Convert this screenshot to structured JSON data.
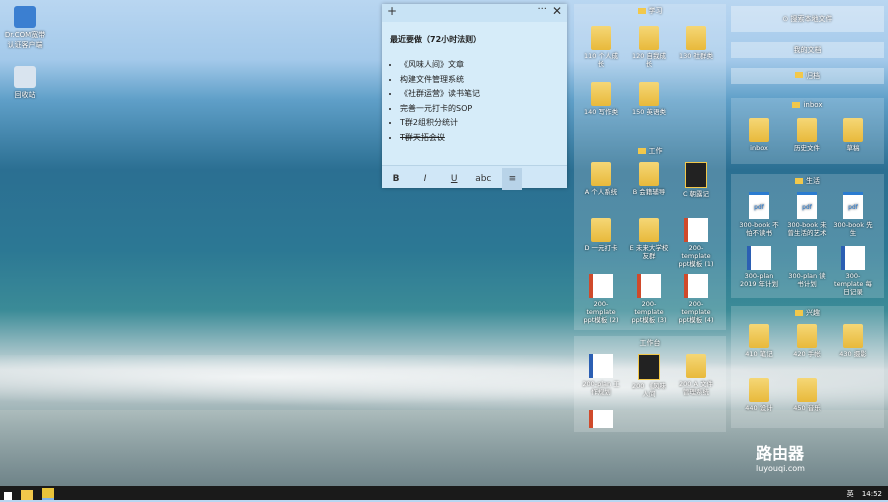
{
  "desktop_icons": [
    {
      "label": "Dr.COM宽带认证客户端",
      "icon": "network-icon"
    },
    {
      "label": "回收站",
      "icon": "recycle-bin-icon"
    }
  ],
  "note": {
    "title": "最近要做（72小时法则）",
    "items": [
      {
        "text": "《风味人间》文章",
        "done": false
      },
      {
        "text": "构建文件管理系统",
        "done": false
      },
      {
        "text": "《社群运营》读书笔记",
        "done": false
      },
      {
        "text": "完善一元打卡的SOP",
        "done": false
      },
      {
        "text": "T群2组积分统计",
        "done": false
      },
      {
        "text": "T群天拓会议",
        "done": true
      }
    ],
    "format_bar": [
      "B",
      "I",
      "U",
      "abc",
      "≡"
    ]
  },
  "fences": {
    "study": {
      "title": "学习",
      "items": [
        "110 个人成长",
        "120 自我成长",
        "130 社群类",
        "140 写作类",
        "150 英语类"
      ]
    },
    "work": {
      "title": "工作",
      "items": [
        "A 个人系统",
        "B 会籍辅导",
        "C 朝露记",
        "D 一元打卡",
        "E 未来大学校友群",
        "200-template ppt模板 (1)",
        "200-template ppt模板 (2)",
        "200-template ppt模板 (3)",
        "200-template ppt模板 (4)"
      ]
    },
    "work_files": {
      "title": "工作台",
      "items": [
        "200-plan 工作规划",
        "200 《风味人间",
        "200 A 文件管理系统"
      ]
    },
    "inbox": {
      "title": "inbox",
      "items": [
        "inbox",
        "历史文件",
        "草稿"
      ]
    },
    "life": {
      "title": "生活",
      "items": [
        "300-book 不怕不读书",
        "300-book 未曾生活的艺术",
        "300-book 先生",
        "300-plan 2019 年计划",
        "300-plan 读书计划",
        "300-template 每日记录"
      ]
    },
    "interest": {
      "title": "兴趣",
      "items": [
        "410 笔记",
        "420 手帐",
        "430 摄影",
        "440 设计",
        "450 音乐"
      ]
    }
  },
  "right_bars": {
    "search": "搜索本地文件",
    "all_files": "我的文档",
    "folder": "归档"
  },
  "taskbar": {
    "time": "14:52",
    "tray": "英"
  },
  "watermark": {
    "text": "路由器",
    "sub": "luyouqi.com"
  }
}
